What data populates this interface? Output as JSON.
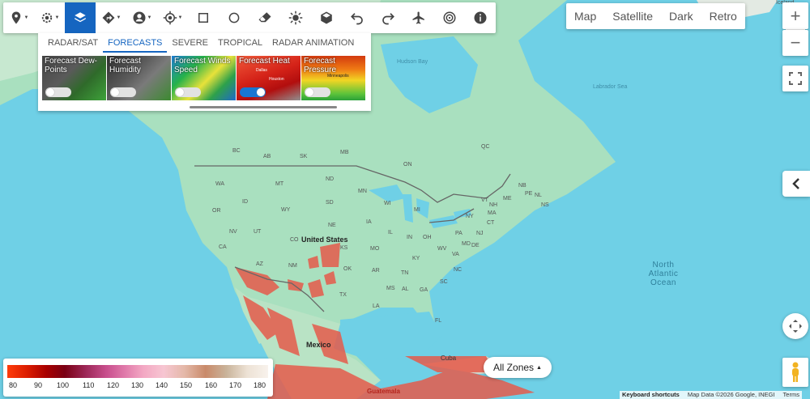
{
  "toolbar": {
    "buttons": [
      "pin-icon",
      "settings-icon",
      "layers-icon",
      "directions-icon",
      "user-icon",
      "gps-icon",
      "square-icon",
      "circle-icon",
      "eraser-icon",
      "sun-icon",
      "cube-icon",
      "undo-icon",
      "redo-icon",
      "airplane-icon",
      "radar-icon",
      "info-icon"
    ],
    "active": "layers-icon"
  },
  "panel": {
    "tabs": [
      "RADAR/SAT",
      "FORECASTS",
      "SEVERE",
      "TROPICAL",
      "RADAR ANIMATION"
    ],
    "active_tab": "FORECASTS",
    "cards": [
      {
        "title": "Forecast Dew-Points",
        "enabled": false
      },
      {
        "title": "Forecast Humidity",
        "enabled": false
      },
      {
        "title": "Forecast Winds Speed",
        "enabled": false
      },
      {
        "title": "Forecast Heat",
        "enabled": true
      },
      {
        "title": "Forecast Pressure",
        "enabled": false
      }
    ],
    "card_sublabels": {
      "heat_top": "Dallas",
      "heat_bottom": "Houston",
      "pressure": "Minneapolis"
    }
  },
  "map_type": {
    "options": [
      "Map",
      "Satellite",
      "Dark",
      "Retro"
    ]
  },
  "controls": {
    "zoom_in": "+",
    "zoom_out": "−",
    "fullscreen_icon": "fullscreen-icon",
    "collapse_icon": "chevron-left-icon",
    "pan_icon": "pan-icon",
    "pegman_icon": "pegman-icon"
  },
  "map_labels": {
    "top_right": "Iceland",
    "hudson_bay": "Hudson Bay",
    "labrador_sea": "Labrador Sea",
    "qc": "QC",
    "nl": "NL",
    "nb": "NB",
    "ns": "NS",
    "pe": "PE",
    "me": "ME",
    "vt": "VT",
    "nh": "NH",
    "ny": "NY",
    "ma": "MA",
    "ct": "CT",
    "nj": "NJ",
    "pa": "PA",
    "md": "MD",
    "de": "DE",
    "va": "VA",
    "nc": "NC",
    "sc": "SC",
    "ga": "GA",
    "fl": "FL",
    "al": "AL",
    "ms": "MS",
    "la": "LA",
    "tn": "TN",
    "ky": "KY",
    "wv": "WV",
    "oh": "OH",
    "in": "IN",
    "il": "IL",
    "mi": "MI",
    "wi": "WI",
    "mn": "MN",
    "ia": "IA",
    "mo": "MO",
    "ar": "AR",
    "ok": "OK",
    "ks": "KS",
    "ne": "NE",
    "sd": "SD",
    "nd": "ND",
    "mt": "MT",
    "wy": "WY",
    "co": "CO",
    "ut": "UT",
    "id": "ID",
    "wa": "WA",
    "or": "OR",
    "nv": "NV",
    "ca": "CA",
    "az": "AZ",
    "nm": "NM",
    "tx": "TX",
    "us": "United States",
    "mexico": "Mexico",
    "cuba": "Cuba",
    "guatemala": "Guatemala",
    "ocean": "North\nAtlantic\nOcean",
    "bc": "BC",
    "ab": "AB",
    "sk": "SK",
    "mb": "MB",
    "on": "ON"
  },
  "legend": {
    "ticks": [
      "80",
      "90",
      "100",
      "110",
      "120",
      "130",
      "140",
      "150",
      "160",
      "170",
      "180"
    ]
  },
  "all_zones": "All Zones",
  "attribution": {
    "shortcuts": "Keyboard shortcuts",
    "data": "Map Data ©2026 Google, INEGI",
    "terms": "Terms"
  }
}
